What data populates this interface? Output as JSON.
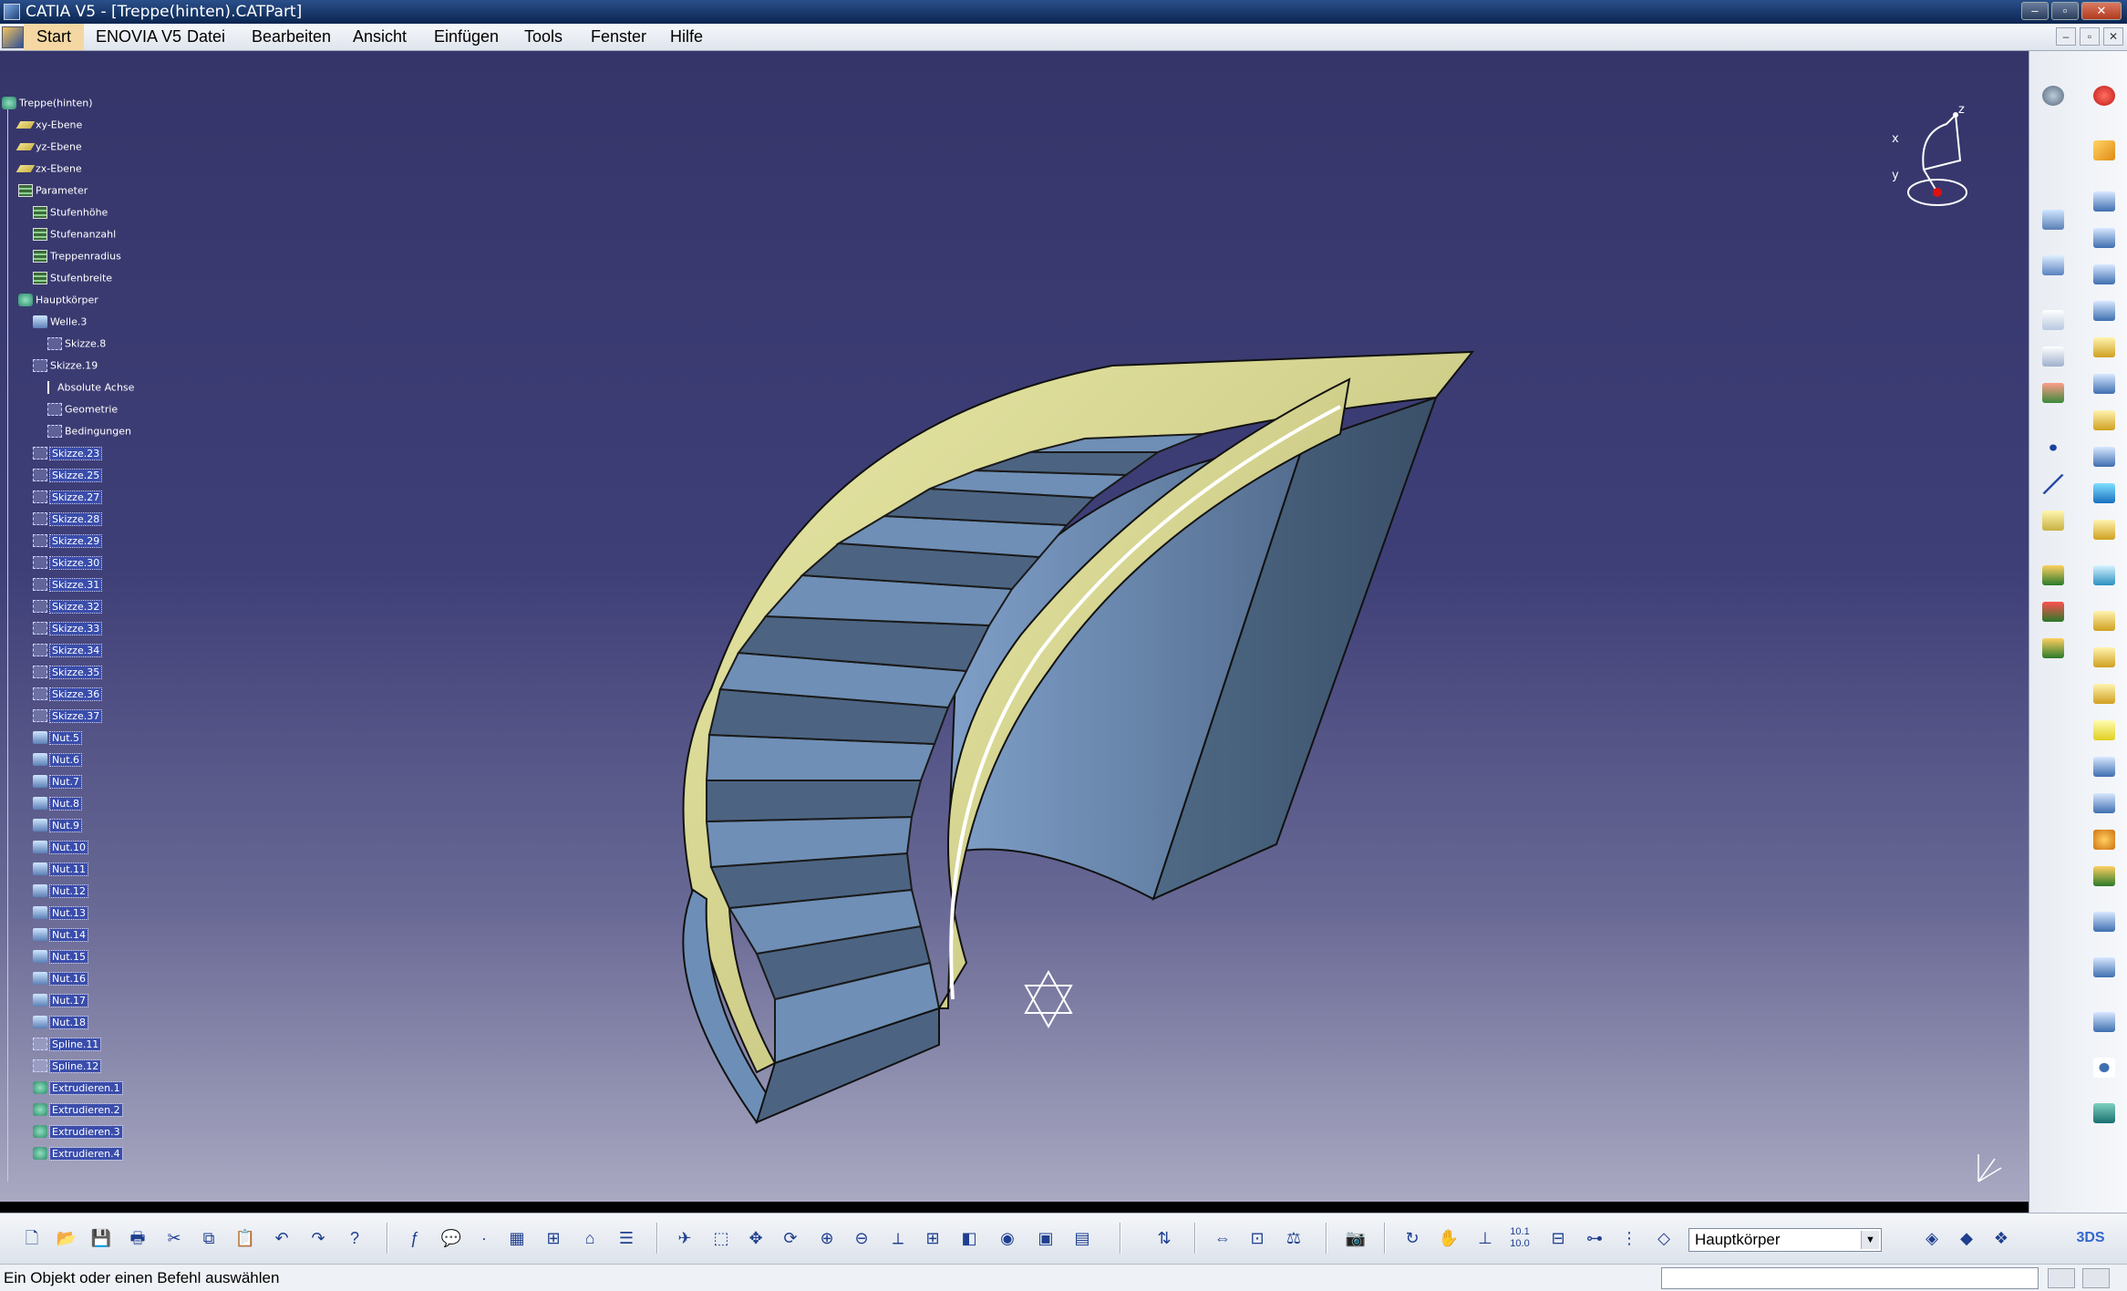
{
  "window": {
    "title": "CATIA V5 - [Treppe(hinten).CATPart]",
    "controls": [
      "–",
      "▫",
      "✕"
    ]
  },
  "menubar": {
    "items": [
      "Start",
      "ENOVIA V5",
      "Datei",
      "Bearbeiten",
      "Ansicht",
      "Einfügen",
      "Tools",
      "Fenster",
      "Hilfe"
    ],
    "doc_controls": [
      "–",
      "▫",
      "✕"
    ]
  },
  "tree": {
    "root": "Treppe(hinten)",
    "planes": [
      "xy-Ebene",
      "yz-Ebene",
      "zx-Ebene"
    ],
    "parameter_label": "Parameter",
    "parameters": [
      "Stufenhöhe",
      "Stufenanzahl",
      "Treppenradius",
      "Stufenbreite"
    ],
    "body_label": "Hauptkörper",
    "body_children": [
      "Welle.3",
      "Skizze.8",
      "Skizze.19",
      "Absolute Achse",
      "Geometrie",
      "Bedingungen",
      "Skizze.23",
      "Skizze.25",
      "Skizze.27",
      "Skizze.28",
      "Skizze.29",
      "Skizze.30",
      "Skizze.31",
      "Skizze.32",
      "Skizze.33",
      "Skizze.34",
      "Skizze.35",
      "Skizze.36",
      "Skizze.37",
      "Nut.5",
      "Nut.6",
      "Nut.7",
      "Nut.8",
      "Nut.9",
      "Nut.10",
      "Nut.11",
      "Nut.12",
      "Nut.13",
      "Nut.14",
      "Nut.15",
      "Nut.16",
      "Nut.17",
      "Nut.18",
      "Spline.11",
      "Spline.12",
      "Extrudieren.1",
      "Extrudieren.2",
      "Extrudieren.3",
      "Extrudieren.4"
    ]
  },
  "compass": {
    "x": "x",
    "y": "y",
    "z": "z"
  },
  "toolbar": {
    "body_selector": "Hauptkörper",
    "zoom_label": "10.1\n10.0"
  },
  "status": {
    "message": "Ein Objekt oder einen Befehl auswählen",
    "command_input": ""
  },
  "colors": {
    "viewport_top": "#35356a",
    "viewport_bottom": "#a9a9c2",
    "model_yellow": "#e1e19a",
    "model_blue": "#6d8fb7",
    "selection": "#3a4dab"
  }
}
